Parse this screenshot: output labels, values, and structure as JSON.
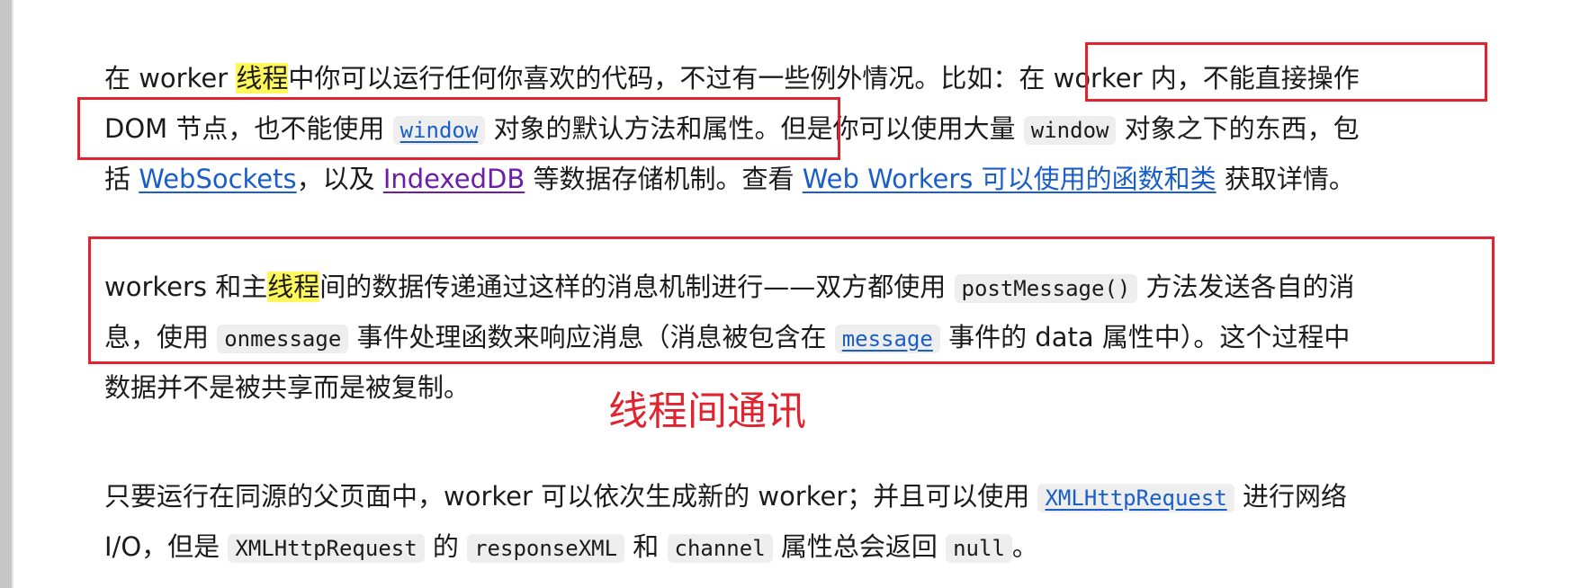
{
  "paragraphs": {
    "p1": {
      "l1_a": "在 worker ",
      "l1_hl": "线程",
      "l1_b": "中你可以运行任何你喜欢的代码，不过有一些例外情况。比如：在 worker 内，不能直接操作",
      "l2_a": "DOM 节点，也不能使用 ",
      "l2_code_link_window": "window",
      "l2_b": " 对象的默认方法和属性。但是你可以使用大量 ",
      "l2_code_window": "window",
      "l2_c": " 对象之下的东西，包",
      "l3_a": "括 ",
      "l3_link_websockets": "WebSockets",
      "l3_b": "，以及 ",
      "l3_link_indexeddb": "IndexedDB",
      "l3_c": " 等数据存储机制。查看 ",
      "l3_link_functions": "Web Workers 可以使用的函数和类",
      "l3_d": " 获取详情。"
    },
    "p2": {
      "l1_a": "workers 和主",
      "l1_hl": "线程",
      "l1_b": "间的数据传递通过这样的消息机制进行——双方都使用 ",
      "l1_code_postmessage": "postMessage()",
      "l1_c": " 方法发送各自的消",
      "l2_a": "息，使用 ",
      "l2_code_onmessage": "onmessage",
      "l2_b": " 事件处理函数来响应消息（消息被包含在 ",
      "l2_code_link_message": "message",
      "l2_c": " 事件的 data 属性中）。这个过程中",
      "l3_a": "数据并不是被共享而是被复制。"
    },
    "p3": {
      "l1_a": "只要运行在同源的父页面中，worker 可以依次生成新的 worker；并且可以使用 ",
      "l1_code_link_xhr": "XMLHttpRequest",
      "l1_b": " 进行网络",
      "l2_a": "I/O，但是 ",
      "l2_code_xhr": "XMLHttpRequest",
      "l2_b": " 的 ",
      "l2_code_responsexml": "responseXML",
      "l2_c": " 和 ",
      "l2_code_channel": "channel",
      "l2_d": " 属性总会返回 ",
      "l2_code_null": "null",
      "l2_e": "。"
    }
  },
  "annotations": {
    "label": "线程间通讯",
    "color": "#e0232e"
  },
  "colors": {
    "highlight": "#fff85a",
    "link": "#1a5ec9",
    "visited_link": "#6b1da8",
    "code_bg": "#eeeeee"
  }
}
